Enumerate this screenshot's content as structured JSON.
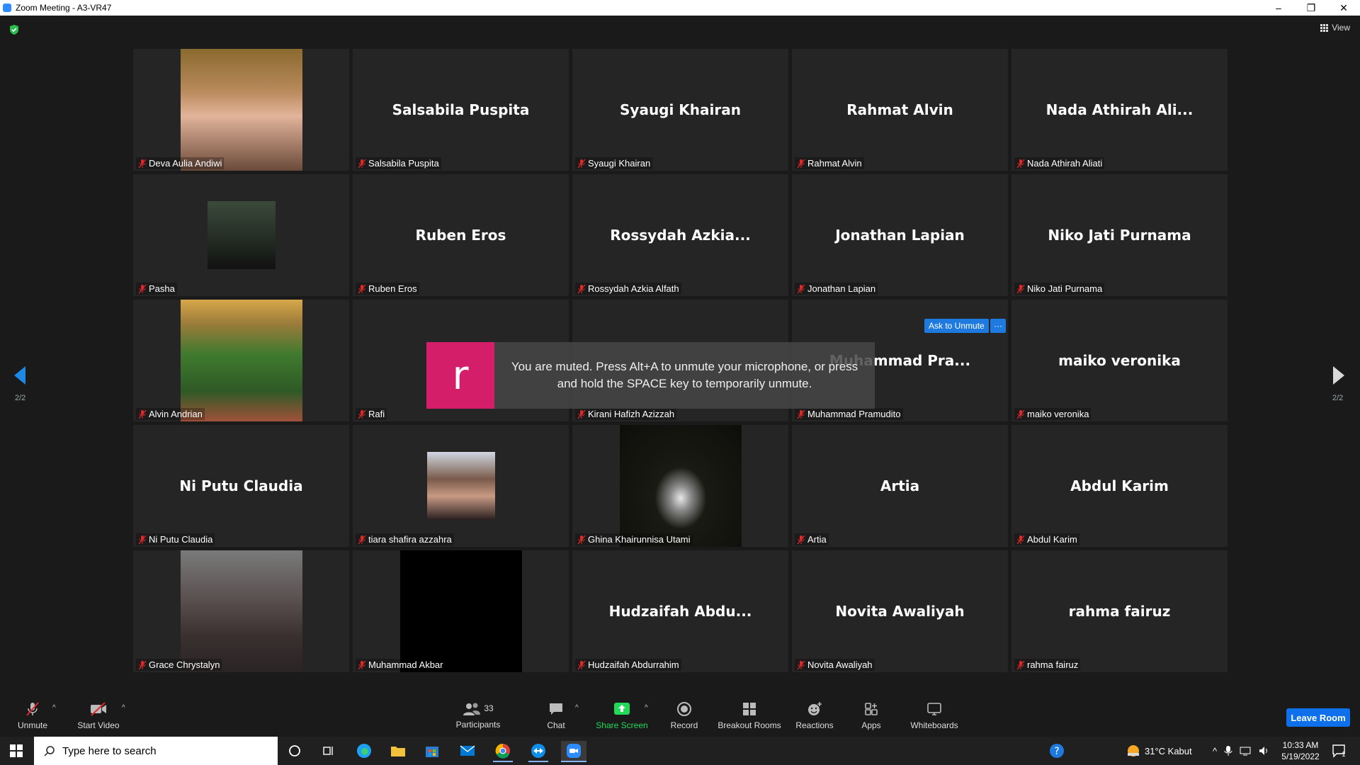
{
  "window": {
    "title": "Zoom Meeting - A3-VR47",
    "minimize": "–",
    "restore": "❐",
    "close": "✕"
  },
  "view_label": "View",
  "tiles": [
    {
      "big": "",
      "label": "Deva Aulia Andiwi",
      "photo": "warm"
    },
    {
      "big": "Salsabila Puspita",
      "label": "Salsabila Puspita"
    },
    {
      "big": "Syaugi Khairan",
      "label": "Syaugi Khairan"
    },
    {
      "big": "Rahmat Alvin",
      "label": "Rahmat Alvin"
    },
    {
      "big": "Nada Athirah Ali...",
      "label": "Nada Athirah Aliati"
    },
    {
      "big": "",
      "label": "Pasha",
      "photo": "dark"
    },
    {
      "big": "Ruben Eros",
      "label": "Ruben Eros"
    },
    {
      "big": "Rossydah Azkia...",
      "label": "Rossydah Azkia Alfath"
    },
    {
      "big": "Jonathan Lapian",
      "label": "Jonathan Lapian"
    },
    {
      "big": "Niko Jati Purnama",
      "label": "Niko Jati Purnama"
    },
    {
      "big": "",
      "label": "Alvin Andrian",
      "photo": "garden"
    },
    {
      "big": "",
      "label": "Rafi"
    },
    {
      "big": "",
      "label": "Kirani Hafizh Azizzah"
    },
    {
      "big": "Muhammad Pra...",
      "label": "Muhammad Pramudito"
    },
    {
      "big": "maiko veronika",
      "label": "maiko veronika"
    },
    {
      "big": "Ni Putu Claudia",
      "label": "Ni Putu Claudia"
    },
    {
      "big": "",
      "label": "tiara shafira azzahra",
      "photo": "face"
    },
    {
      "big": "",
      "label": "Ghina Khairunnisa Utami",
      "photo": "night"
    },
    {
      "big": "Artia",
      "label": "Artia"
    },
    {
      "big": "Abdul Karim",
      "label": "Abdul Karim"
    },
    {
      "big": "",
      "label": "Grace Chrystalyn",
      "photo": "grey"
    },
    {
      "big": "",
      "label": "Muhammad Akbar",
      "photo": "black"
    },
    {
      "big": "Hudzaifah Abdu...",
      "label": "Hudzaifah Abdurrahim"
    },
    {
      "big": "Novita Awaliyah",
      "label": "Novita Awaliyah"
    },
    {
      "big": "rahma fairuz",
      "label": "rahma fairuz"
    }
  ],
  "page_indicator": "2/2",
  "toast": {
    "avatar_letter": "r",
    "message": "You are muted. Press Alt+A to unmute your microphone, or press and hold the SPACE key to temporarily unmute."
  },
  "ask_to_unmute": "Ask to Unmute",
  "more_dots": "···",
  "toolbar": {
    "unmute": "Unmute",
    "start_video": "Start Video",
    "participants": "Participants",
    "participants_count": "33",
    "chat": "Chat",
    "share_screen": "Share Screen",
    "record": "Record",
    "breakout": "Breakout Rooms",
    "reactions": "Reactions",
    "apps": "Apps",
    "whiteboards": "Whiteboards",
    "leave": "Leave Room"
  },
  "taskbar": {
    "search_placeholder": "Type here to search",
    "weather": "31°C  Kabut",
    "time": "10:33 AM",
    "date": "5/19/2022",
    "notif_count": "1"
  },
  "colors": {
    "accent": "#0e71eb",
    "share_green": "#23d959",
    "muted_red": "#e02828",
    "toast_avatar": "#d41e6a"
  }
}
